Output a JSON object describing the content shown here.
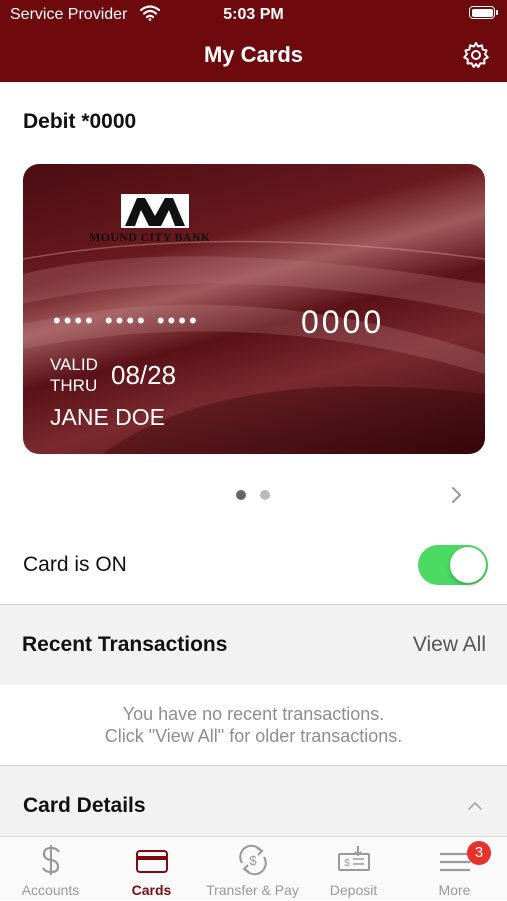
{
  "status_bar": {
    "carrier": "Service Provider",
    "time": "5:03 PM"
  },
  "header": {
    "title": "My Cards"
  },
  "card": {
    "title": "Debit *0000",
    "bank_name": "MOUND CITY BANK",
    "masked_groups": "•••• •••• ••••",
    "last4": "0000",
    "valid_label_line1": "VALID",
    "valid_label_line2": "THRU",
    "expiry": "08/28",
    "cardholder": "JANE DOE",
    "pager": {
      "current": 1,
      "total": 2
    }
  },
  "card_status": {
    "label": "Card is ON",
    "on": true,
    "color": "#4cd964"
  },
  "recent_transactions": {
    "title": "Recent Transactions",
    "view_all": "View All",
    "empty_line1": "You have no recent transactions.",
    "empty_line2": "Click \"View All\" for older transactions."
  },
  "card_details": {
    "title": "Card Details"
  },
  "tab_bar": {
    "items": [
      {
        "label": "Accounts",
        "icon": "dollar-icon"
      },
      {
        "label": "Cards",
        "icon": "card-icon",
        "active": true
      },
      {
        "label": "Transfer & Pay",
        "icon": "transfer-icon"
      },
      {
        "label": "Deposit",
        "icon": "deposit-icon"
      },
      {
        "label": "More",
        "icon": "menu-icon",
        "badge": "3"
      }
    ]
  },
  "colors": {
    "brand": "#6e0a0e",
    "active_tab": "#7a0c12",
    "badge": "#e5322c",
    "toggle_on": "#4cd964"
  }
}
